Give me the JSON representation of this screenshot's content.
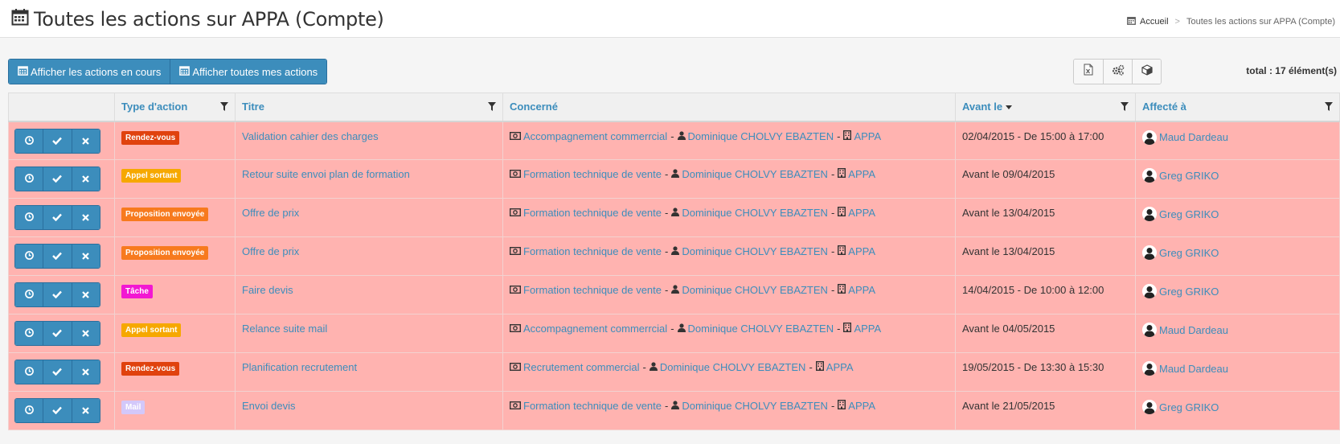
{
  "page": {
    "title": "Toutes les actions sur APPA (Compte)",
    "breadcrumb": {
      "home": "Accueil",
      "current": "Toutes les actions sur APPA (Compte)"
    }
  },
  "toolbar": {
    "show_current_label": "Afficher les actions en cours",
    "show_all_label": "Afficher toutes mes actions",
    "tools": [
      "excel-export-icon",
      "settings-gears-icon",
      "cube-icon"
    ],
    "total": "total : 17 élément(s)"
  },
  "colors": {
    "primary": "#3c8dbc",
    "row_bg": "#ffb3b0",
    "badge_rdv": "#e0420e",
    "badge_appel": "#f6a800",
    "badge_proposition": "#f77a1e",
    "badge_tache": "#f218d2",
    "badge_mail": "#d3c8fa"
  },
  "table": {
    "headers": {
      "type": "Type d'action",
      "titre": "Titre",
      "concerne": "Concerné",
      "avant": "Avant le",
      "affecte": "Affecté à"
    },
    "rows": [
      {
        "type": "Rendez-vous",
        "type_color": "#e0420e",
        "titre": "Validation cahier des charges",
        "concerne": {
          "opportunite": "Accompagnement commerrcial",
          "contact": "Dominique CHOLVY EBAZTEN",
          "compte": "APPA"
        },
        "avant": "02/04/2015 - De 15:00 à 17:00",
        "affecte": "Maud Dardeau"
      },
      {
        "type": "Appel sortant",
        "type_color": "#f6a800",
        "titre": "Retour suite envoi plan de formation",
        "concerne": {
          "opportunite": "Formation technique de vente",
          "contact": "Dominique CHOLVY EBAZTEN",
          "compte": "APPA"
        },
        "avant": "Avant le 09/04/2015",
        "affecte": "Greg GRIKO"
      },
      {
        "type": "Proposition envoyée",
        "type_color": "#f77a1e",
        "titre": "Offre de prix",
        "concerne": {
          "opportunite": "Formation technique de vente",
          "contact": "Dominique CHOLVY EBAZTEN",
          "compte": "APPA"
        },
        "avant": "Avant le 13/04/2015",
        "affecte": "Greg GRIKO"
      },
      {
        "type": "Proposition envoyée",
        "type_color": "#f77a1e",
        "titre": "Offre de prix",
        "concerne": {
          "opportunite": "Formation technique de vente",
          "contact": "Dominique CHOLVY EBAZTEN",
          "compte": "APPA"
        },
        "avant": "Avant le 13/04/2015",
        "affecte": "Greg GRIKO"
      },
      {
        "type": "Tâche",
        "type_color": "#f218d2",
        "titre": "Faire devis",
        "concerne": {
          "opportunite": "Formation technique de vente",
          "contact": "Dominique CHOLVY EBAZTEN",
          "compte": "APPA"
        },
        "avant": "14/04/2015 - De 10:00 à 12:00",
        "affecte": "Greg GRIKO"
      },
      {
        "type": "Appel sortant",
        "type_color": "#f6a800",
        "titre": "Relance suite mail",
        "concerne": {
          "opportunite": "Accompagnement commerrcial",
          "contact": "Dominique CHOLVY EBAZTEN",
          "compte": "APPA"
        },
        "avant": "Avant le 04/05/2015",
        "affecte": "Maud Dardeau"
      },
      {
        "type": "Rendez-vous",
        "type_color": "#e0420e",
        "titre": "Planification recrutement",
        "concerne": {
          "opportunite": "Recrutement commercial",
          "contact": "Dominique CHOLVY EBAZTEN",
          "compte": "APPA"
        },
        "avant": "19/05/2015 - De 13:30 à 15:30",
        "affecte": "Maud Dardeau"
      },
      {
        "type": "Mail",
        "type_color": "#d3c8fa",
        "titre": "Envoi devis",
        "concerne": {
          "opportunite": "Formation technique de vente",
          "contact": "Dominique CHOLVY EBAZTEN",
          "compte": "APPA"
        },
        "avant": "Avant le 21/05/2015",
        "affecte": "Greg GRIKO"
      }
    ]
  }
}
